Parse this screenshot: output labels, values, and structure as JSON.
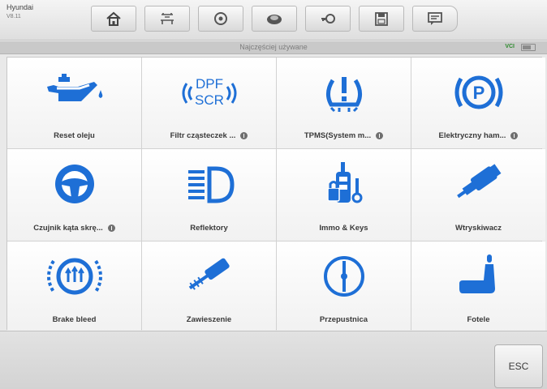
{
  "vehicle": {
    "make": "Hyundai",
    "model": "V8.11"
  },
  "toolbar": {
    "buttons": [
      {
        "icon": "home-icon"
      },
      {
        "icon": "car-lift-icon"
      },
      {
        "icon": "settings-icon"
      },
      {
        "icon": "car-icon"
      },
      {
        "icon": "key-car-icon"
      },
      {
        "icon": "save-icon"
      },
      {
        "icon": "message-icon"
      }
    ]
  },
  "subbar": {
    "title": "Najczęściej używane",
    "vci": "VCI"
  },
  "colors": {
    "accent": "#1e6fd6",
    "tile_label": "#3a3a3a"
  },
  "tiles": [
    {
      "label": "Reset oleju",
      "icon": "oil-can-icon",
      "info": false
    },
    {
      "label": "Filtr cząsteczek ...",
      "icon": "dpf-scr-icon",
      "info": true
    },
    {
      "label": "TPMS(System m...",
      "icon": "tpms-icon",
      "info": true
    },
    {
      "label": "Elektryczny ham...",
      "icon": "parking-brake-icon",
      "info": true
    },
    {
      "label": "Czujnik kąta skrę...",
      "icon": "steering-wheel-icon",
      "info": true
    },
    {
      "label": "Reflektory",
      "icon": "headlight-icon",
      "info": false
    },
    {
      "label": "Immo & Keys",
      "icon": "immo-keys-icon",
      "info": false
    },
    {
      "label": "Wtryskiwacz",
      "icon": "injector-icon",
      "info": false
    },
    {
      "label": "Brake bleed",
      "icon": "brake-bleed-icon",
      "info": false
    },
    {
      "label": "Zawieszenie",
      "icon": "suspension-icon",
      "info": false
    },
    {
      "label": "Przepustnica",
      "icon": "throttle-icon",
      "info": false
    },
    {
      "label": "Fotele",
      "icon": "seat-icon",
      "info": false
    }
  ],
  "bottom": {
    "esc_label": "ESC"
  }
}
